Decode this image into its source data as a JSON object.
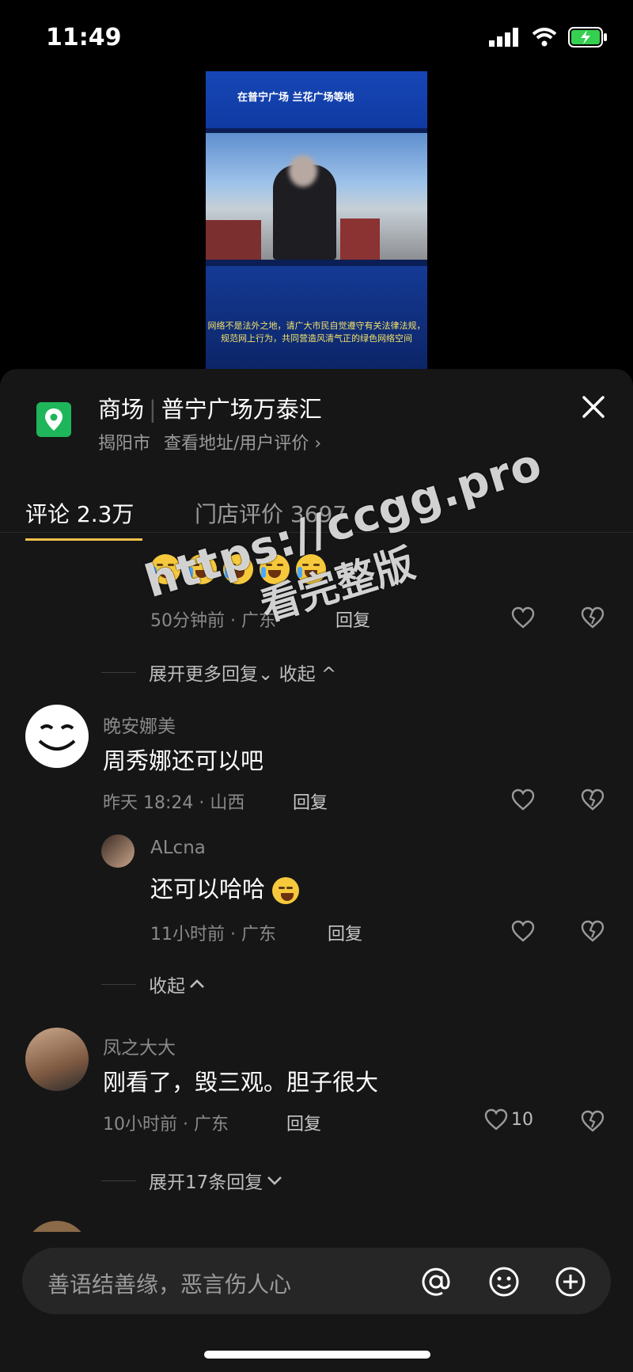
{
  "status": {
    "time": "11:49"
  },
  "video": {
    "caption_top": "在普宁广场  兰花广场等地",
    "caption_bottom": "网络不是法外之地，请广大市民自觉遵守有关法律法规，规范网上行为，共同营造风清气正的绿色网络空间"
  },
  "location": {
    "category": "商场",
    "name": "普宁广场万泰汇",
    "city": "揭阳市",
    "link": "查看地址/用户评价 ›"
  },
  "tabs": [
    {
      "label": "评论 2.3万",
      "active": true
    },
    {
      "label": "门店评价 3697",
      "active": false
    }
  ],
  "comments": {
    "c0": {
      "time_loc": "50分钟前 · 广东",
      "reply": "回复",
      "expand": "展开更多回复⌄ 收起 ^"
    },
    "c1": {
      "user": "晚安娜美",
      "text": "周秀娜还可以吧",
      "time_loc": "昨天 18:24 · 山西",
      "reply": "回复"
    },
    "c1r": {
      "user": "ALcna",
      "text": "还可以哈哈",
      "time_loc": "11小时前 · 广东",
      "reply": "回复"
    },
    "collapse": "收起",
    "c2": {
      "user": "凤之大大",
      "text": "刚看了，毁三观。胆子很大",
      "time_loc": "10小时前 · 广东",
      "reply": "回复",
      "likes": "10"
    },
    "c2_expand": "展开17条回复"
  },
  "watermark": {
    "line1": "https://ccgg.pro",
    "line2": "看完整版"
  },
  "input": {
    "placeholder": "善语结善缘，恶言伤人心"
  },
  "colors": {
    "accent": "#f1c24a",
    "location_icon": "#1fb55a",
    "sheet_bg": "#161616"
  }
}
